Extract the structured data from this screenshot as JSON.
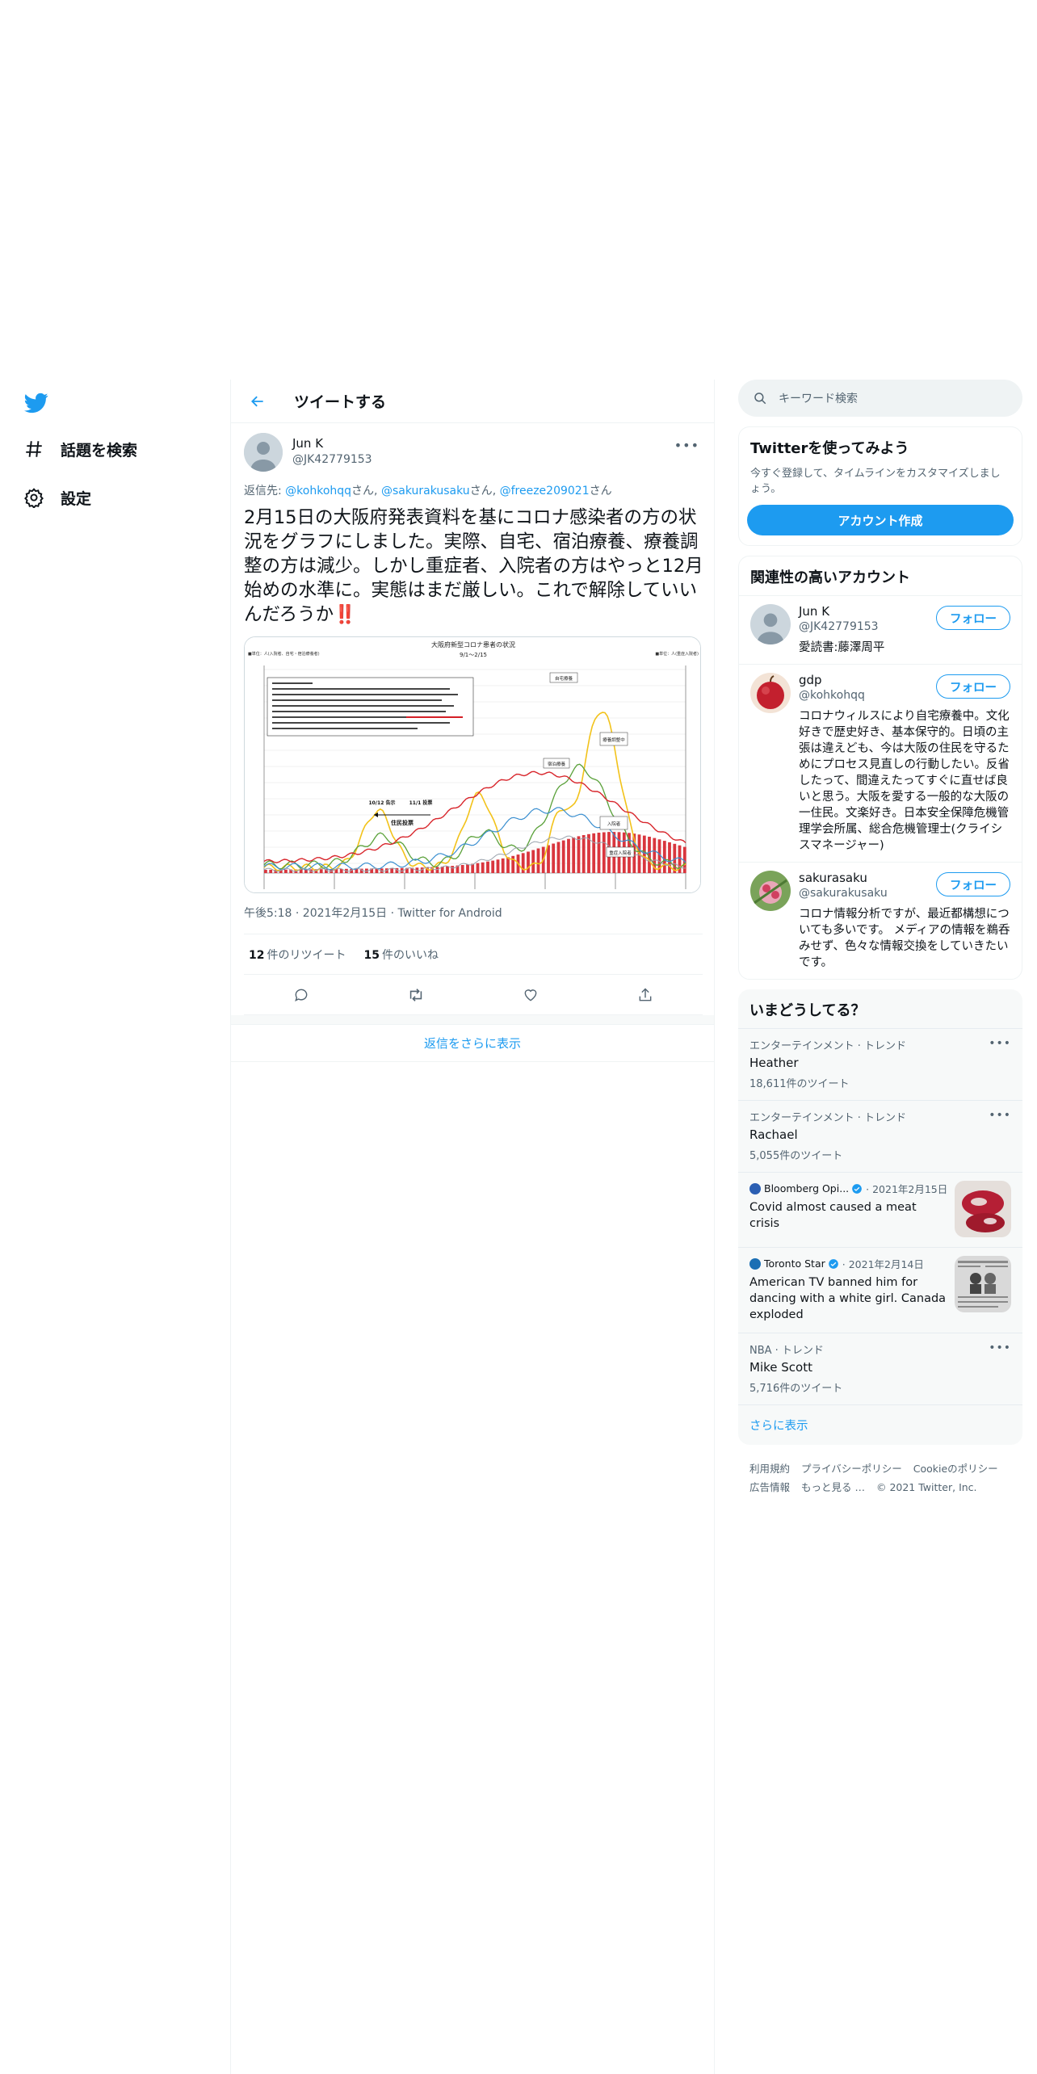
{
  "nav": {
    "items": [
      {
        "label": "話題を検索",
        "icon": "hashtag-icon"
      },
      {
        "label": "設定",
        "icon": "gear-icon"
      }
    ]
  },
  "header": {
    "title": "ツイートする"
  },
  "tweet": {
    "author_name": "Jun K",
    "author_handle": "@JK42779153",
    "reply_prefix": "返信先: ",
    "mentions": [
      "@kohkohqq",
      "@sakurakusaku",
      "@freeze209021"
    ],
    "mention_suffix": "さん",
    "separator": ", ",
    "text": "2月15日の大阪府発表資料を基にコロナ感染者の方の状況をグラフにしました。実際、自宅、宿泊療養、療養調整の方は減少。しかし重症者、入院者の方はやっと12月始めの水準に。実態はまだ厳しい。これで解除していいんだろうか",
    "emoji": "‼️",
    "timestamp": "午後5:18 · 2021年2月15日 · Twitter for Android",
    "retweets": "12",
    "retweets_label": "件のリツイート",
    "likes": "15",
    "likes_label": "件のいいね"
  },
  "chart": {
    "title": "大阪府新型コロナ患者の状況",
    "subtitle": "9/1～2/15",
    "left_unit": "■単位：人(入院者、自宅・宿泊療養者)",
    "right_unit": "■単位：人(重症入院者)",
    "labels": [
      "自宅療養",
      "宿泊療養",
      "入院者",
      "重症入院者",
      "療養調整中"
    ],
    "annotation_left": "10/12 告示",
    "annotation_right": "11/1 投票",
    "annotation_bottom": "住民投票"
  },
  "replies": {
    "show_more": "返信をさらに表示"
  },
  "sidebar": {
    "search_placeholder": "キーワード検索",
    "signup": {
      "title": "Twitterを使ってみよう",
      "desc": "今すぐ登録して、タイムラインをカスタマイズしましょう。",
      "button": "アカウント作成"
    },
    "related": {
      "title": "関連性の高いアカウント",
      "follow_label": "フォロー",
      "accounts": [
        {
          "name": "Jun K",
          "handle": "@JK42779153",
          "bio": "愛読書:藤澤周平"
        },
        {
          "name": "gdp",
          "handle": "@kohkohqq",
          "bio": "コロナウィルスにより自宅療養中。文化好きで歴史好き、基本保守的。日頃の主張は違えども、今は大阪の住民を守るためにプロセス見直しの行動したい。反省したって、間違えたってすぐに直せば良いと思う。大阪を愛する一般的な大阪の一住民。文楽好き。日本安全保障危機管理学会所属、総合危機管理士(クライシスマネージャー)"
        },
        {
          "name": "sakurasaku",
          "handle": "@sakurakusaku",
          "bio": "コロナ情報分析ですが、最近都構想についても多いです。 メディアの情報を鵜呑みせず、色々な情報交換をしていきたいです。"
        }
      ]
    },
    "trends": {
      "title": "いまどうしてる？",
      "items": [
        {
          "category": "エンターテインメント · トレンド",
          "name": "Heather",
          "count": "18,611件のツイート"
        },
        {
          "category": "エンターテインメント · トレンド",
          "name": "Rachael",
          "count": "5,055件のツイート"
        }
      ],
      "news": [
        {
          "source": "Bloomberg Opi...",
          "date": "· 2021年2月15日",
          "headline": "Covid almost caused a meat crisis"
        },
        {
          "source": "Toronto Star",
          "date": "· 2021年2月14日",
          "headline": "American TV banned him for dancing with a white girl. Canada exploded"
        }
      ],
      "last": {
        "category": "NBA · トレンド",
        "name": "Mike Scott",
        "count": "5,716件のツイート"
      },
      "show_more": "さらに表示"
    },
    "footer": {
      "line1": [
        "利用規約",
        "プライバシーポリシー",
        "Cookieのポリシー"
      ],
      "line2": [
        "広告情報",
        "もっと見る …",
        "© 2021 Twitter, Inc."
      ]
    }
  },
  "colors": {
    "accent": "#1d9bf0",
    "text": "#0f1419",
    "muted": "#536471"
  }
}
